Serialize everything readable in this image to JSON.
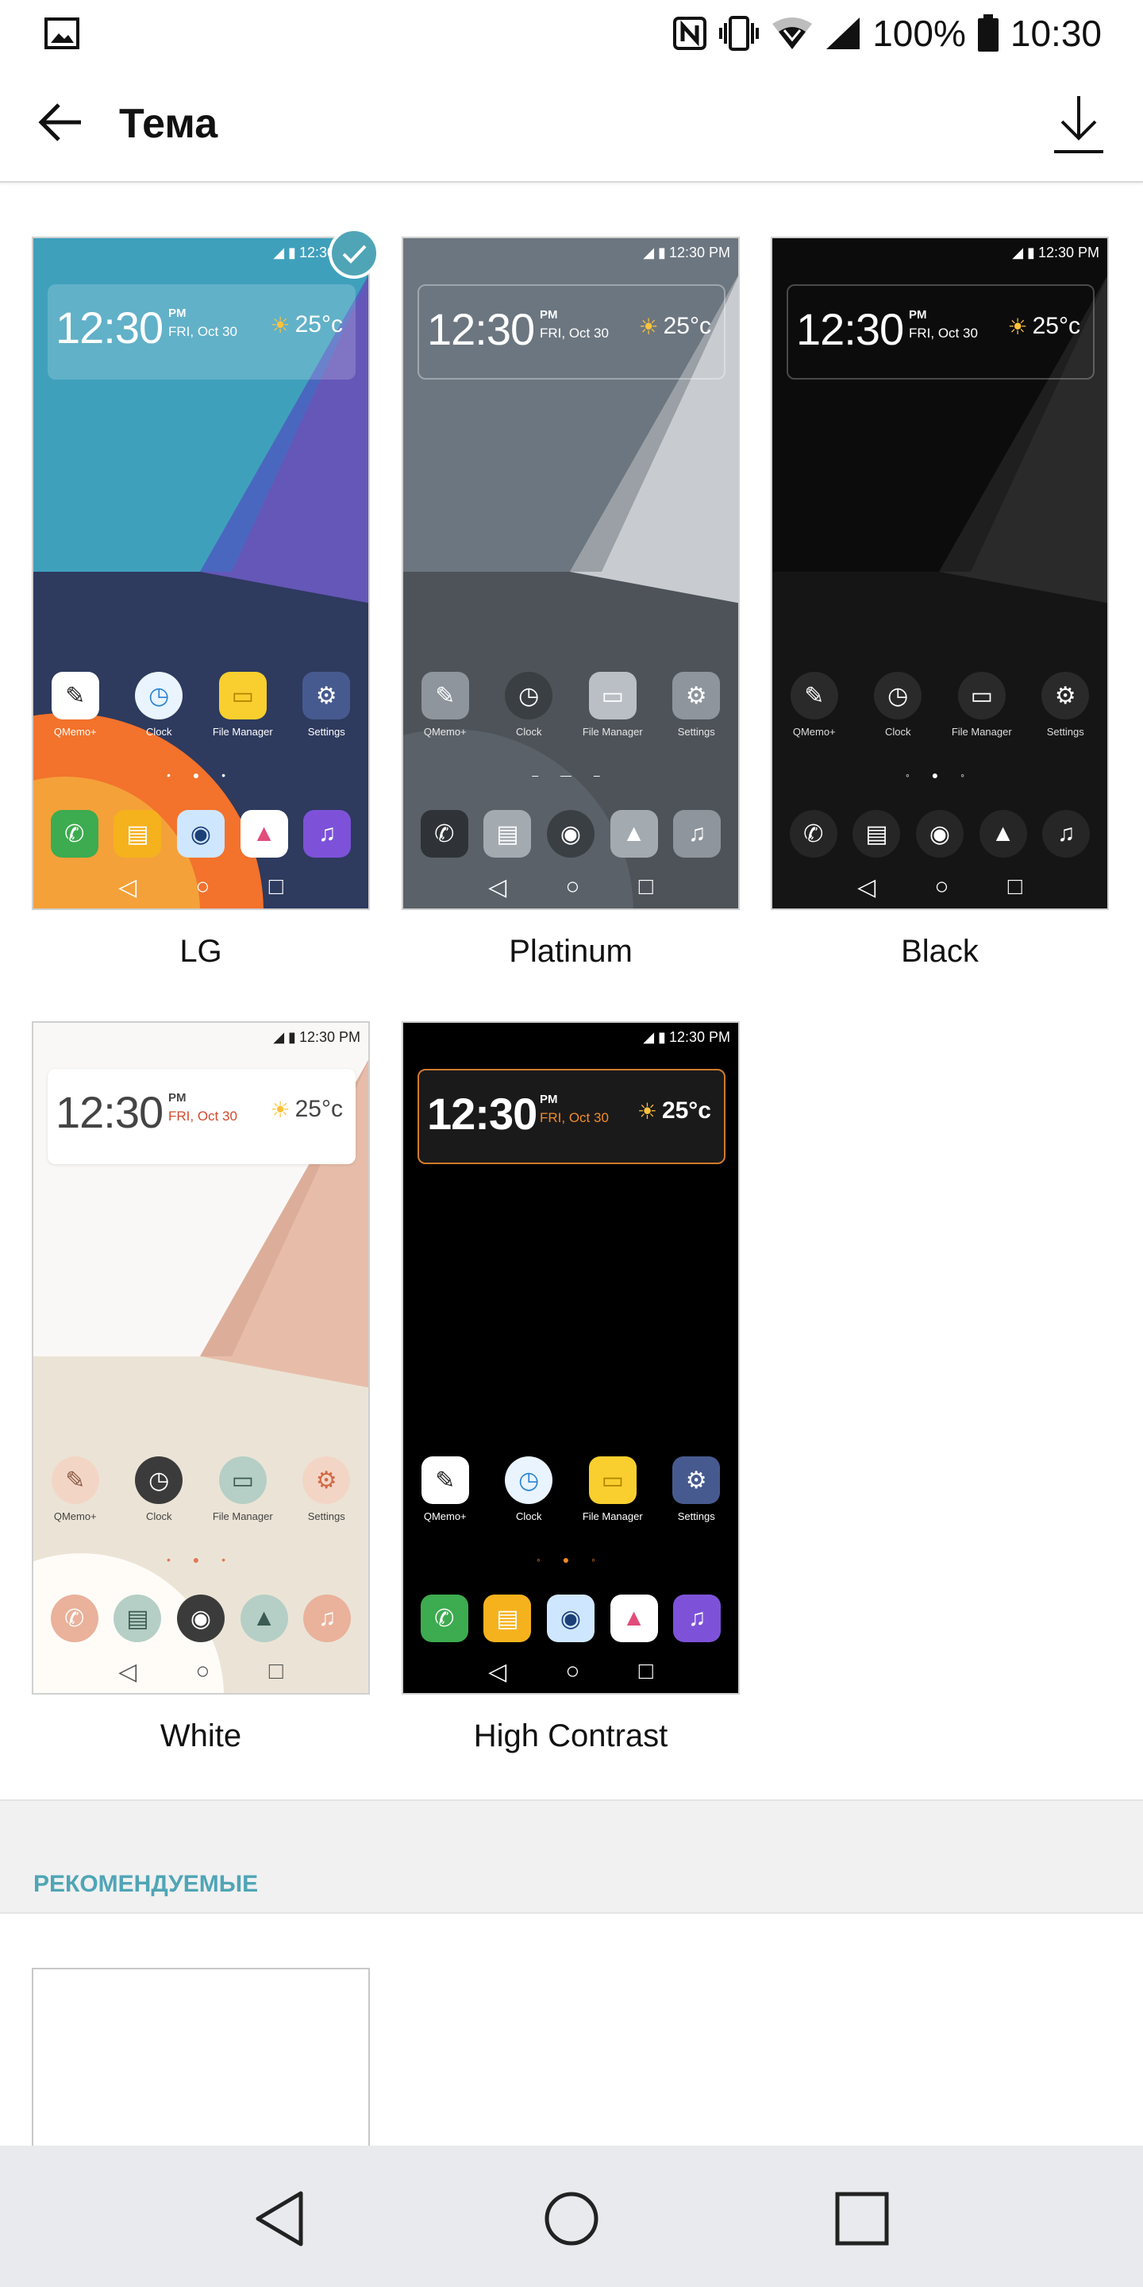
{
  "status_bar": {
    "gallery_icon": "image-icon",
    "icons": [
      "nfc-icon",
      "vibrate-icon",
      "wifi-icon",
      "signal-icon",
      "battery-icon"
    ],
    "battery": "100%",
    "time": "10:30"
  },
  "app_bar": {
    "back_icon": "arrow-back-icon",
    "title": "Тема",
    "download_icon": "download-icon"
  },
  "themes": [
    {
      "name": "LG",
      "selected": true,
      "preview": {
        "status_time": "12:30 PM",
        "time": "12:30",
        "ampm": "PM",
        "date": "FRI, Oct 30",
        "temp": "25°c",
        "apps": [
          "QMemo+",
          "Clock",
          "File Manager",
          "Settings"
        ]
      }
    },
    {
      "name": "Platinum",
      "selected": false,
      "preview": {
        "status_time": "12:30 PM",
        "time": "12:30",
        "ampm": "PM",
        "date": "FRI, Oct 30",
        "temp": "25°c",
        "apps": [
          "QMemo+",
          "Clock",
          "File Manager",
          "Settings"
        ]
      }
    },
    {
      "name": "Black",
      "selected": false,
      "preview": {
        "status_time": "12:30 PM",
        "time": "12:30",
        "ampm": "PM",
        "date": "FRI, Oct 30",
        "temp": "25°c",
        "apps": [
          "QMemo+",
          "Clock",
          "File Manager",
          "Settings"
        ]
      }
    },
    {
      "name": "White",
      "selected": false,
      "preview": {
        "status_time": "12:30 PM",
        "time": "12:30",
        "ampm": "PM",
        "date": "FRI, Oct 30",
        "temp": "25°c",
        "apps": [
          "QMemo+",
          "Clock",
          "File Manager",
          "Settings"
        ]
      }
    },
    {
      "name": "High Contrast",
      "selected": false,
      "preview": {
        "status_time": "12:30 PM",
        "time": "12:30",
        "ampm": "PM",
        "date": "FRI, Oct 30",
        "temp": "25°c",
        "apps": [
          "QMemo+",
          "Clock",
          "File Manager",
          "Settings"
        ]
      }
    }
  ],
  "recommended": {
    "title": "РЕКОМЕНДУЕМЫЕ"
  },
  "nav": {
    "back_icon": "nav-back-icon",
    "home_icon": "nav-home-icon",
    "recents_icon": "nav-recents-icon"
  },
  "colors": {
    "accent": "#4fa5b6",
    "nav_bg": "#e9eaee",
    "section_bg": "#f1f1f1"
  }
}
